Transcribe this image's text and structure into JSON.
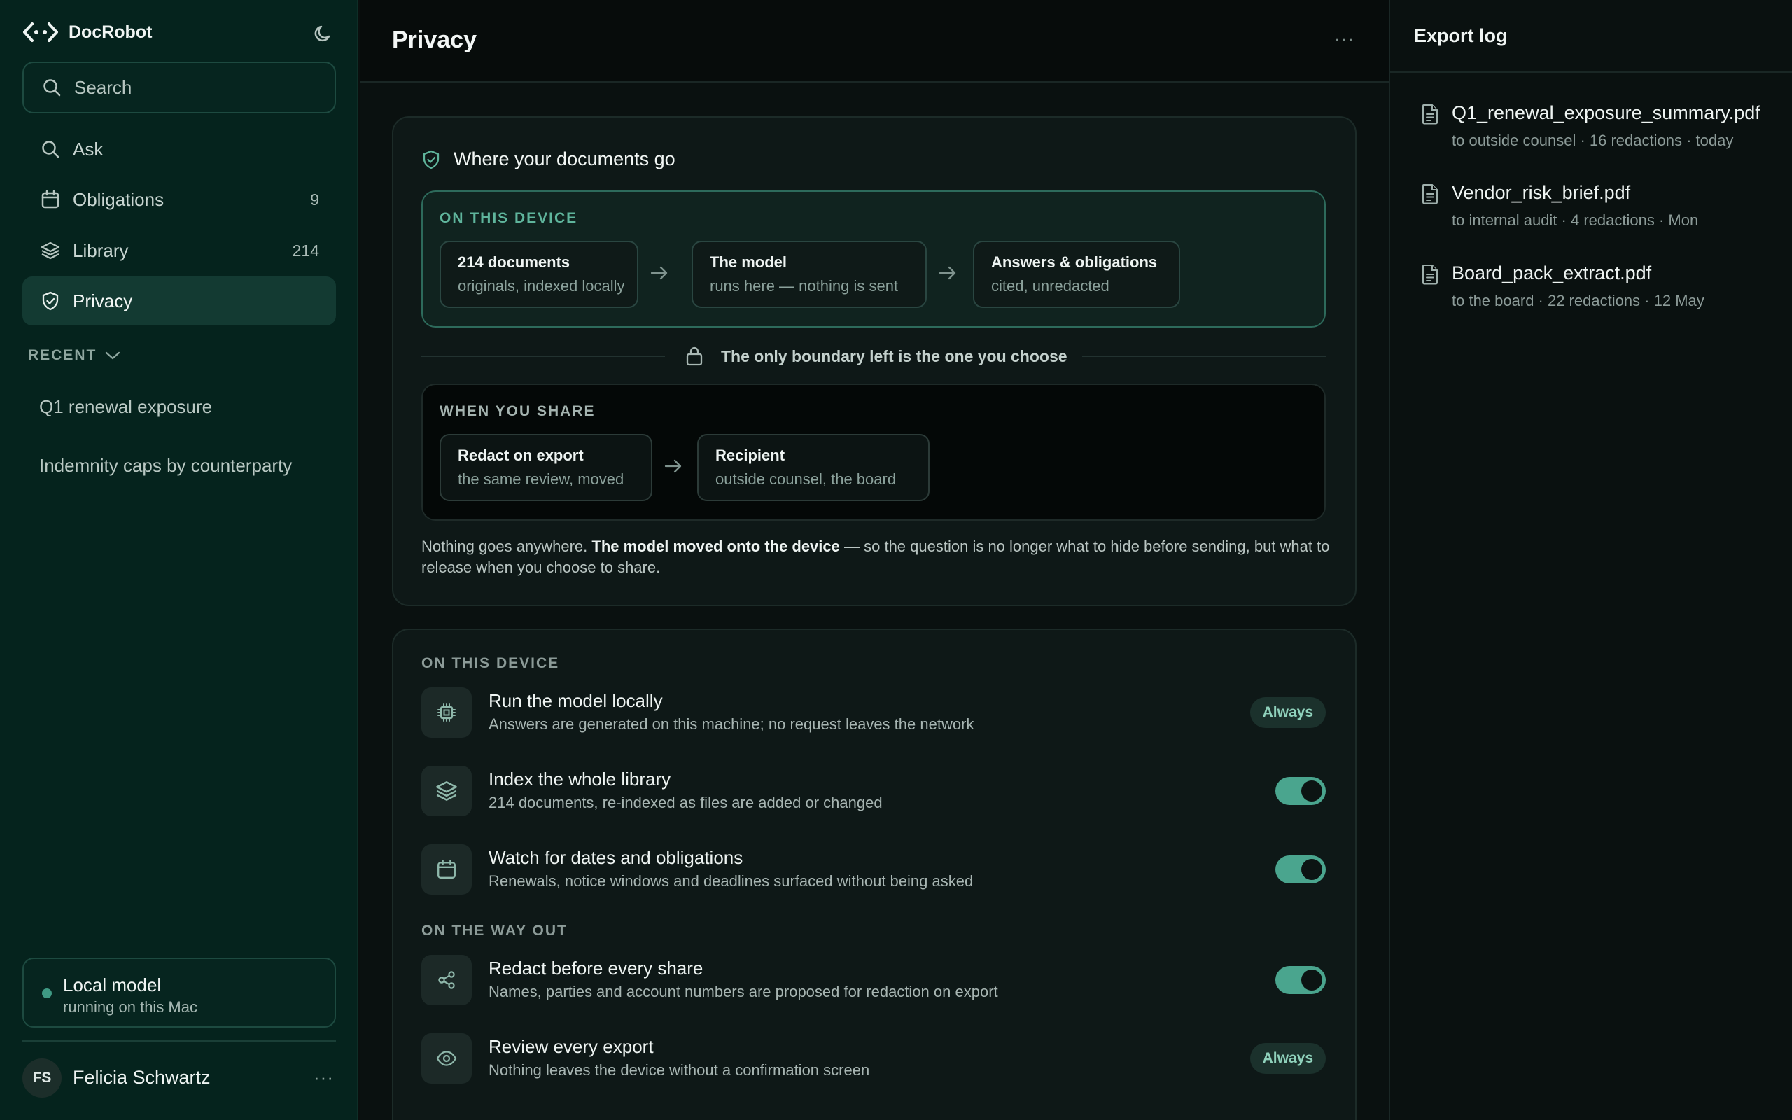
{
  "app": {
    "name": "DocRobot"
  },
  "sidebar": {
    "search_placeholder": "Search",
    "nav": [
      {
        "label": "Ask",
        "icon": "search-icon"
      },
      {
        "label": "Obligations",
        "count": "9",
        "icon": "calendar-icon"
      },
      {
        "label": "Library",
        "count": "214",
        "icon": "layers-icon"
      },
      {
        "label": "Privacy",
        "icon": "shield-icon",
        "active": true
      }
    ],
    "recent_label": "RECENT",
    "recent": [
      "Q1 renewal exposure",
      "Indemnity caps by counterparty"
    ],
    "local_model": {
      "title": "Local model",
      "subtitle": "running on this Mac",
      "status_color": "#3f9a84"
    },
    "user": {
      "initials": "FS",
      "name": "Felicia Schwartz",
      "more": "···"
    }
  },
  "main": {
    "title": "Privacy",
    "more": "···",
    "overview": {
      "heading": "Where your documents go",
      "device": {
        "label": "ON THIS DEVICE",
        "nodes": [
          {
            "title": "214 documents",
            "subtitle": "originals, indexed locally"
          },
          {
            "title": "The model",
            "subtitle": "runs here — nothing is sent"
          },
          {
            "title": "Answers & obligations",
            "subtitle": "cited, unredacted"
          }
        ]
      },
      "boundary": "The only boundary left is the one you choose",
      "share": {
        "label": "WHEN YOU SHARE",
        "nodes": [
          {
            "title": "Redact on export",
            "subtitle": "the same review, moved"
          },
          {
            "title": "Recipient",
            "subtitle": "outside counsel, the board"
          }
        ]
      },
      "note_pre": "Nothing goes anywhere. ",
      "note_bold": "The model moved onto the device",
      "note_post": " — so the question is no longer what to hide before sending, but what to release when you choose to share."
    },
    "settings": {
      "device_label": "ON THIS DEVICE",
      "way_out_label": "ON THE WAY OUT",
      "items": [
        {
          "title": "Run the model locally",
          "subtitle": "Answers are generated on this machine; no request leaves the network",
          "control": "badge",
          "badge": "Always",
          "icon": "chip-icon"
        },
        {
          "title": "Index the whole library",
          "subtitle": "214 documents, re-indexed as files are added or changed",
          "control": "toggle",
          "on": true,
          "icon": "layers-icon"
        },
        {
          "title": "Watch for dates and obligations",
          "subtitle": "Renewals, notice windows and deadlines surfaced without being asked",
          "control": "toggle",
          "on": true,
          "icon": "calendar-icon"
        },
        {
          "title": "Redact before every share",
          "subtitle": "Names, parties and account numbers are proposed for redaction on export",
          "control": "toggle",
          "on": true,
          "icon": "share-icon"
        },
        {
          "title": "Review every export",
          "subtitle": "Nothing leaves the device without a confirmation screen",
          "control": "badge",
          "badge": "Always",
          "icon": "eye-icon"
        }
      ]
    }
  },
  "export_log": {
    "title": "Export log",
    "items": [
      {
        "name": "Q1_renewal_exposure_summary.pdf",
        "meta": "to outside counsel · 16 redactions · today"
      },
      {
        "name": "Vendor_risk_brief.pdf",
        "meta": "to internal audit · 4 redactions · Mon"
      },
      {
        "name": "Board_pack_extract.pdf",
        "meta": "to the board · 22 redactions · 12 May"
      }
    ]
  },
  "colors": {
    "accent": "#4aa58e",
    "sidebar_bg": "#05231d",
    "badge_text": "#8fd1bb"
  }
}
